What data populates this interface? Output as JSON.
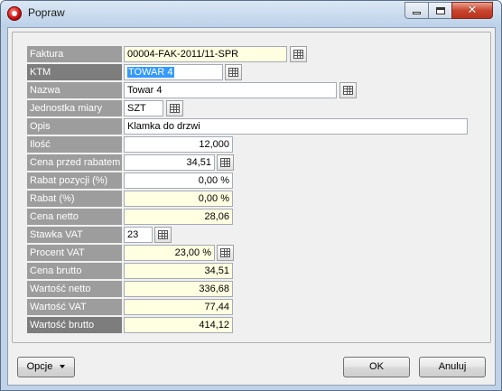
{
  "window": {
    "title": "Popraw"
  },
  "fields": {
    "faktura": {
      "label": "Faktura",
      "value": "00004-FAK-2011/11-SPR"
    },
    "ktm": {
      "label": "KTM",
      "value": "TOWAR 4"
    },
    "nazwa": {
      "label": "Nazwa",
      "value": "Towar 4"
    },
    "jednostka": {
      "label": "Jednostka miary",
      "value": "SZT"
    },
    "opis": {
      "label": "Opis",
      "value": "Klamka do drzwi"
    },
    "ilosc": {
      "label": "Ilość",
      "value": "12,000"
    },
    "cena_przed_rabatem": {
      "label": "Cena przed rabatem",
      "value": "34,51"
    },
    "rabat_pozycji": {
      "label": "Rabat pozycji (%)",
      "value": "0,00 %"
    },
    "rabat": {
      "label": "Rabat (%)",
      "value": "0,00 %"
    },
    "cena_netto": {
      "label": "Cena netto",
      "value": "28,06"
    },
    "stawka_vat": {
      "label": "Stawka VAT",
      "value": "23"
    },
    "procent_vat": {
      "label": "Procent VAT",
      "value": "23,00 %"
    },
    "cena_brutto": {
      "label": "Cena brutto",
      "value": "34,51"
    },
    "wartosc_netto": {
      "label": "Wartość netto",
      "value": "336,68"
    },
    "wartosc_vat": {
      "label": "Wartość VAT",
      "value": "77,44"
    },
    "wartosc_brutto": {
      "label": "Wartość brutto",
      "value": "414,12"
    }
  },
  "buttons": {
    "opcje": "Opcje",
    "ok": "OK",
    "anuluj": "Anuluj"
  },
  "icons": {
    "app": "app-logo-icon",
    "lookup": "table-grid-icon"
  },
  "colors": {
    "label_bg": "#9d9d9d",
    "readonly_bg": "#ffffe1",
    "selection": "#3399ff"
  }
}
